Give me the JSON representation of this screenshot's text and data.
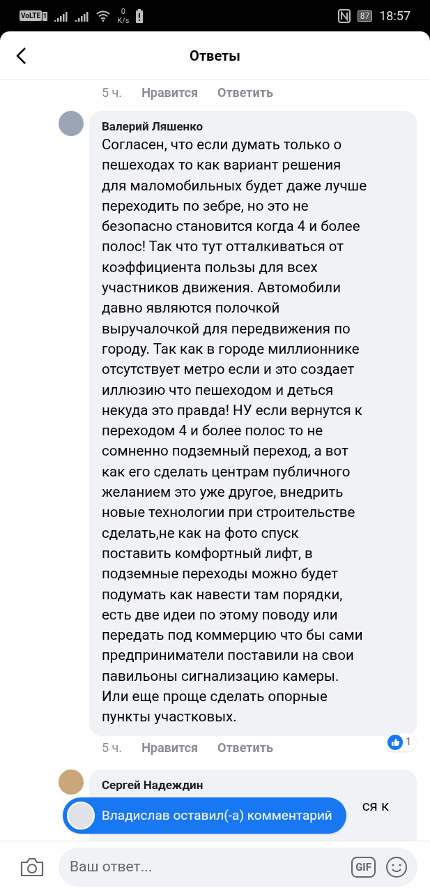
{
  "status_bar": {
    "volte": "VoLTE",
    "sim": "1",
    "speed_value": "0",
    "speed_unit": "K/s",
    "battery": "87",
    "time": "18:57"
  },
  "header": {
    "title": "Ответы"
  },
  "prev_footer": {
    "time": "5 ч.",
    "like": "Нравится",
    "reply": "Ответить"
  },
  "comments": [
    {
      "author": "Валерий Ляшенко",
      "lines": [
        "Согласен, что если думать только о",
        "пешеходах то как вариант решения",
        "для маломобильных будет даже лучше",
        "переходить по зебре, но это не",
        "безопасно становится когда 4 и более",
        "полос! Так что тут отталкиваться от",
        "коэффициента пользы для всех",
        "участников движения. Автомобили",
        "давно являются полочкой",
        "выручалочкой для передвижения по",
        "городу. Так как в городе миллионнике",
        "отсутствует метро если и это создает",
        "иллюзию что пешеходом и деться",
        "некуда это правда! НУ если вернутся к",
        "переходом 4 и более полос то не",
        "сомненно подземный переход, а вот",
        "как его сделать центрам публичного",
        "желанием это уже другое, внедрить",
        "новые технологии при строительстве",
        "сделать,не как на фото спуск",
        "поставить комфортный лифт, в",
        "подземные переходы можно будет",
        "подумать как навести там порядки,",
        "есть две идеи по этому поводу или",
        "передать под коммерцию что бы сами",
        "предприниматели поставили на свои",
        "павильоны сигнализацию камеры.",
        "Или еще проще сделать опорные",
        "пункты участковых."
      ],
      "time": "5 ч.",
      "like": "Нравится",
      "reply": "Ответить",
      "reactions": "1"
    },
    {
      "author": "Сергей Надеждин",
      "visible_fragment": "ся к"
    }
  ],
  "toast": {
    "text": "Владислав оставил(-а) комментарий"
  },
  "composer": {
    "placeholder": "Ваш ответ...",
    "gif": "GIF"
  }
}
